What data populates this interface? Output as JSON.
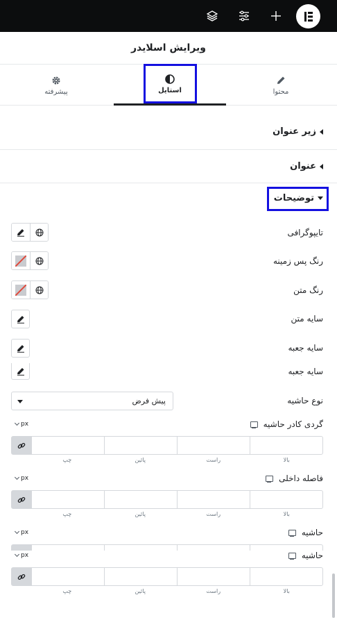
{
  "topbar": {
    "icons": [
      "elementor-logo",
      "add-icon",
      "settings-sliders-icon",
      "layers-icon"
    ]
  },
  "panel_title": "ویرایش اسلایدر",
  "tabs": [
    {
      "label": "محتوا",
      "icon": "pencil-icon"
    },
    {
      "label": "استایل",
      "icon": "half-circle-icon"
    },
    {
      "label": "پیشرفته",
      "icon": "gear-icon"
    }
  ],
  "sections": {
    "subtitle": "زیر عنوان",
    "heading": "عنوان",
    "description": "توضیحات"
  },
  "controls": {
    "typography": "تایپوگرافی",
    "background_color": "رنگ پس زمینه",
    "text_color": "رنگ متن",
    "text_shadow": "سایه متن",
    "box_shadow": "سایه جعبه",
    "box_shadow_2": "سایه جعبه",
    "border_type_label": "نوع حاشیه",
    "border_type_value": "پیش فرض",
    "border_radius": "گردی کادر حاشیه",
    "padding": "فاصله داخلی",
    "margin": "حاشیه",
    "margin_2": "حاشیه",
    "unit": "px"
  },
  "dimension_labels": {
    "top": "بالا",
    "right": "راست",
    "bottom": "پائین",
    "left": "چپ"
  },
  "colors": {
    "highlight": "#1410e0",
    "topbar": "#0c0d0e"
  }
}
